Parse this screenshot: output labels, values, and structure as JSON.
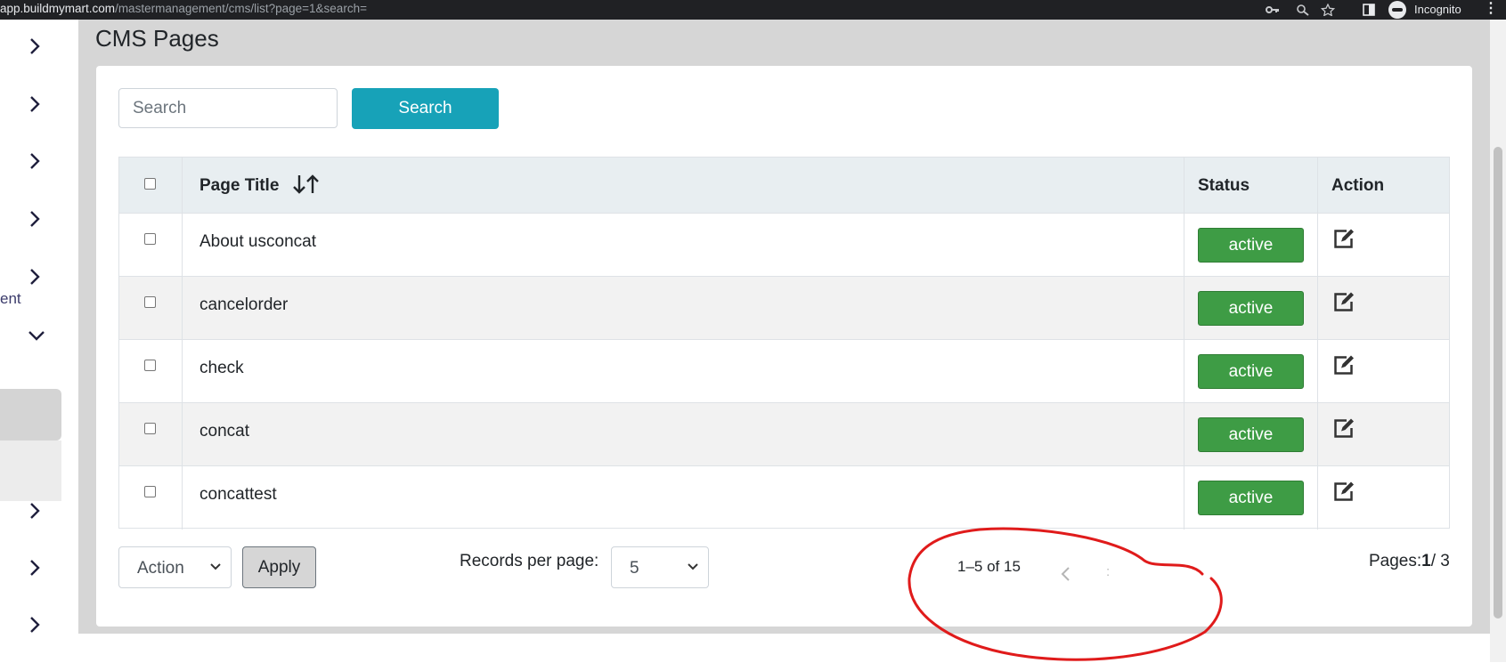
{
  "browser": {
    "url_host": "app.buildmymart.com",
    "url_path": "/mastermanagement/cms/list?page=1&search=",
    "incognito_label": "Incognito",
    "icons": [
      "key-icon",
      "zoom-icon",
      "star-icon",
      "sidepanel-icon",
      "incognito-icon",
      "kebab-menu-icon"
    ]
  },
  "sidebar": {
    "partial_label": "ent",
    "chevrons": [
      "right",
      "right",
      "right",
      "right",
      "right",
      "down",
      "right",
      "right",
      "right"
    ]
  },
  "page": {
    "title": "CMS Pages"
  },
  "search": {
    "placeholder": "Search",
    "value": "",
    "button_label": "Search"
  },
  "table": {
    "columns": [
      "Page Title",
      "Status",
      "Action"
    ],
    "sort_icon": "sort-arrows-icon",
    "rows": [
      {
        "title": "About usconcat",
        "status": "active"
      },
      {
        "title": "cancelorder",
        "status": "active"
      },
      {
        "title": "check",
        "status": "active"
      },
      {
        "title": "concat",
        "status": "active"
      },
      {
        "title": "concattest",
        "status": "active"
      }
    ]
  },
  "footer": {
    "action_select": "Action",
    "apply_label": "Apply",
    "records_label": "Records per page:",
    "records_value": "5",
    "range_text": "1–5 of 15",
    "pages_prefix": "Pages:",
    "current_page": "1",
    "pages_suffix": "/ 3"
  },
  "colors": {
    "search_button": "#17a2b8",
    "status_badge": "#3e9c45",
    "annotation": "#e01b1b"
  }
}
